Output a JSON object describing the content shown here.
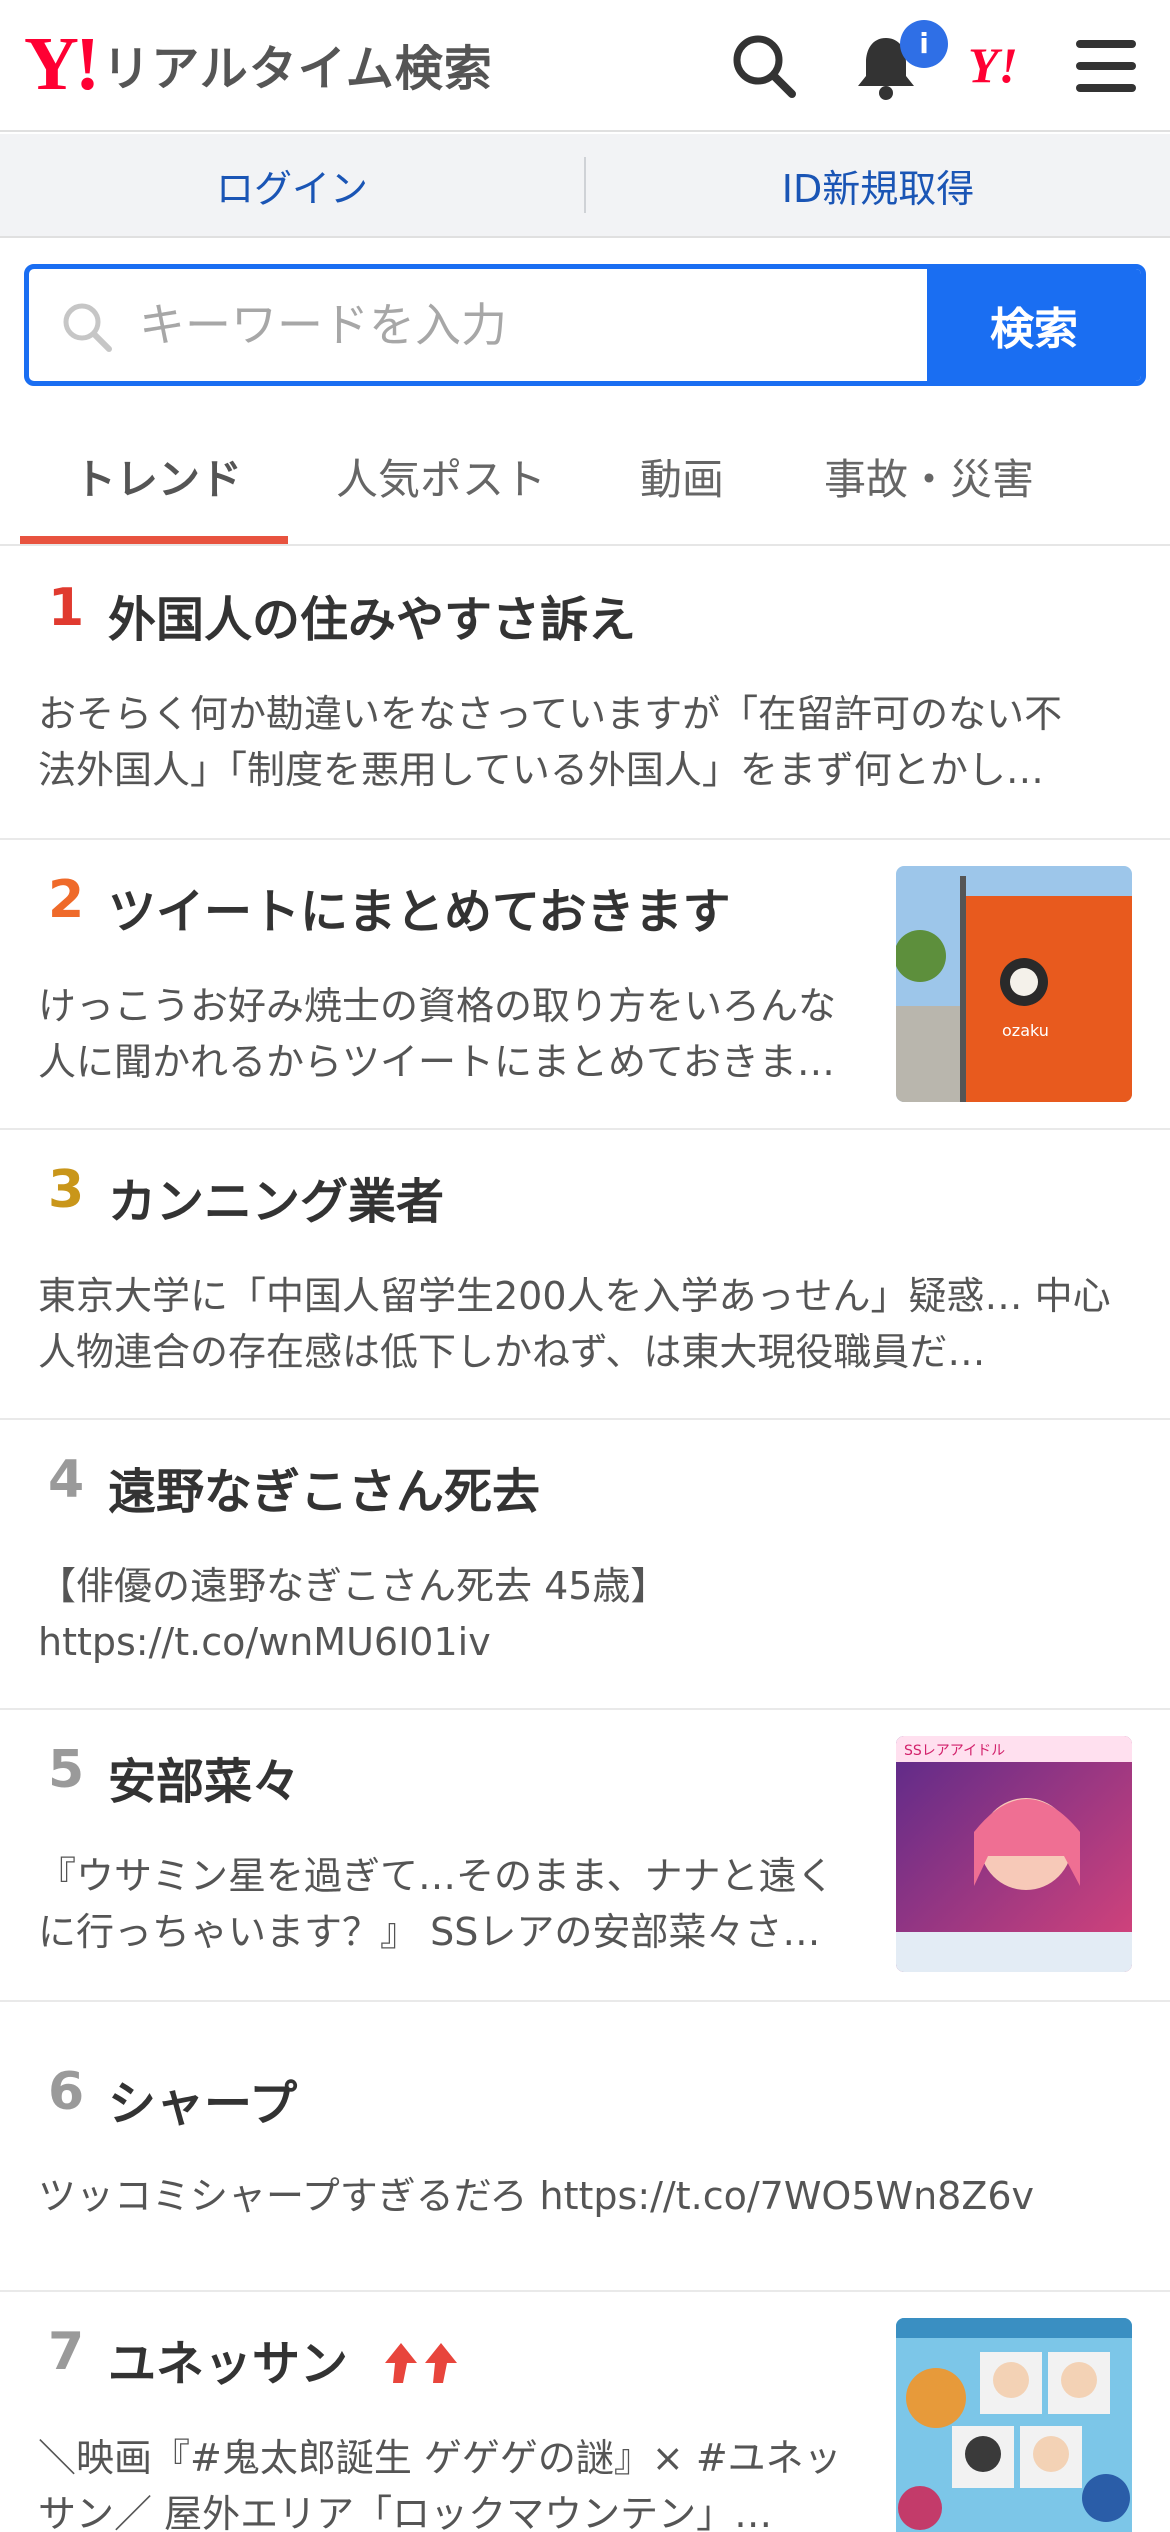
{
  "header": {
    "logo_mark": "Y!",
    "logo_text": "リアルタイム検索",
    "notification_badge": "i",
    "yahoo_japan_mark": "Y!",
    "icons": [
      "search-icon",
      "bell-icon",
      "yahoo-japan-logo",
      "hamburger-menu-icon"
    ]
  },
  "loginbar": {
    "login": "ログイン",
    "signup": "ID新規取得"
  },
  "search": {
    "placeholder": "キーワードを入力",
    "value": "",
    "button": "検索"
  },
  "tabs": [
    {
      "label": "トレンド",
      "active": true
    },
    {
      "label": "人気ポスト",
      "active": false
    },
    {
      "label": "動画",
      "active": false
    },
    {
      "label": "事故・災害",
      "active": false
    }
  ],
  "trends": [
    {
      "rank": "1",
      "title": "外国人の住みやすさ訴え",
      "desc": "おそらく何か勘違いをなさっていますが「在留許可のない不法外国人」「制度を悪用している外国人」をまず何とかし…",
      "rank_color": "#e03a2f",
      "has_thumb": false
    },
    {
      "rank": "2",
      "title": "ツイートにまとめておきます",
      "desc": "けっこうお好み焼士の資格の取り方をいろんな人に聞かれるからツイートにまとめておきま…",
      "rank_color": "#ef6a2a",
      "has_thumb": true,
      "thumb_text": "ozaku"
    },
    {
      "rank": "3",
      "title": "カンニング業者",
      "desc": "東京大学に「中国人留学生200人を入学あっせん」疑惑… 中心人物連合の存在感は低下しかねず、は東大現役職員だ…",
      "rank_color": "#c9961a",
      "has_thumb": false
    },
    {
      "rank": "4",
      "title": "遠野なぎこさん死去",
      "desc": "【俳優の遠野なぎこさん死去 45歳】 https://t.co/wnMU6I01iv",
      "rank_color": "#9a9a9a",
      "has_thumb": false
    },
    {
      "rank": "5",
      "title": "安部菜々",
      "desc": "『ウサミン星を過ぎて…そのまま、ナナと遠くに行っちゃいます？』 SSレアの安部菜々さ…",
      "rank_color": "#9a9a9a",
      "has_thumb": true,
      "thumb_text": "SSレアアイドル"
    },
    {
      "rank": "6",
      "title": "シャープ",
      "desc": "ツッコミシャープすぎるだろ https://t.co/7WO5Wn8Z6v",
      "rank_color": "#9a9a9a",
      "has_thumb": false
    },
    {
      "rank": "7",
      "title": "ユネッサン",
      "desc": "＼映画『#鬼太郎誕生 ゲゲゲの謎』× #ユネッサン／ 屋外エリア「ロックマウンテン」…",
      "rank_color": "#9a9a9a",
      "has_thumb": true,
      "trending_up": true
    }
  ]
}
